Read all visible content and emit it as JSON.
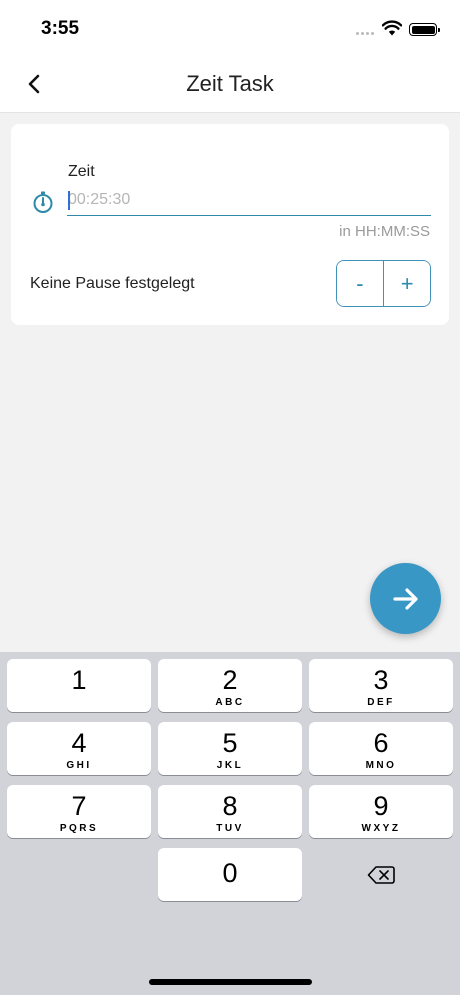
{
  "status_bar": {
    "time": "3:55"
  },
  "nav": {
    "title": "Zeit Task"
  },
  "form": {
    "time_label": "Zeit",
    "time_placeholder": "00:25:30",
    "time_hint": "in HH:MM:SS",
    "pause_label": "Keine Pause festgelegt",
    "stepper_minus": "-",
    "stepper_plus": "+"
  },
  "icons": {
    "back": "chevron-left-icon",
    "timer": "stopwatch-icon",
    "next": "arrow-right-icon",
    "delete": "backspace-icon"
  },
  "colors": {
    "accent": "#2e8aa8",
    "fab": "#3897c5",
    "caret": "#2f6fd6"
  },
  "keyboard": {
    "keys": [
      {
        "digit": "1",
        "letters": ""
      },
      {
        "digit": "2",
        "letters": "ABC"
      },
      {
        "digit": "3",
        "letters": "DEF"
      },
      {
        "digit": "4",
        "letters": "GHI"
      },
      {
        "digit": "5",
        "letters": "JKL"
      },
      {
        "digit": "6",
        "letters": "MNO"
      },
      {
        "digit": "7",
        "letters": "PQRS"
      },
      {
        "digit": "8",
        "letters": "TUV"
      },
      {
        "digit": "9",
        "letters": "WXYZ"
      },
      {
        "digit": "0",
        "letters": ""
      }
    ]
  }
}
